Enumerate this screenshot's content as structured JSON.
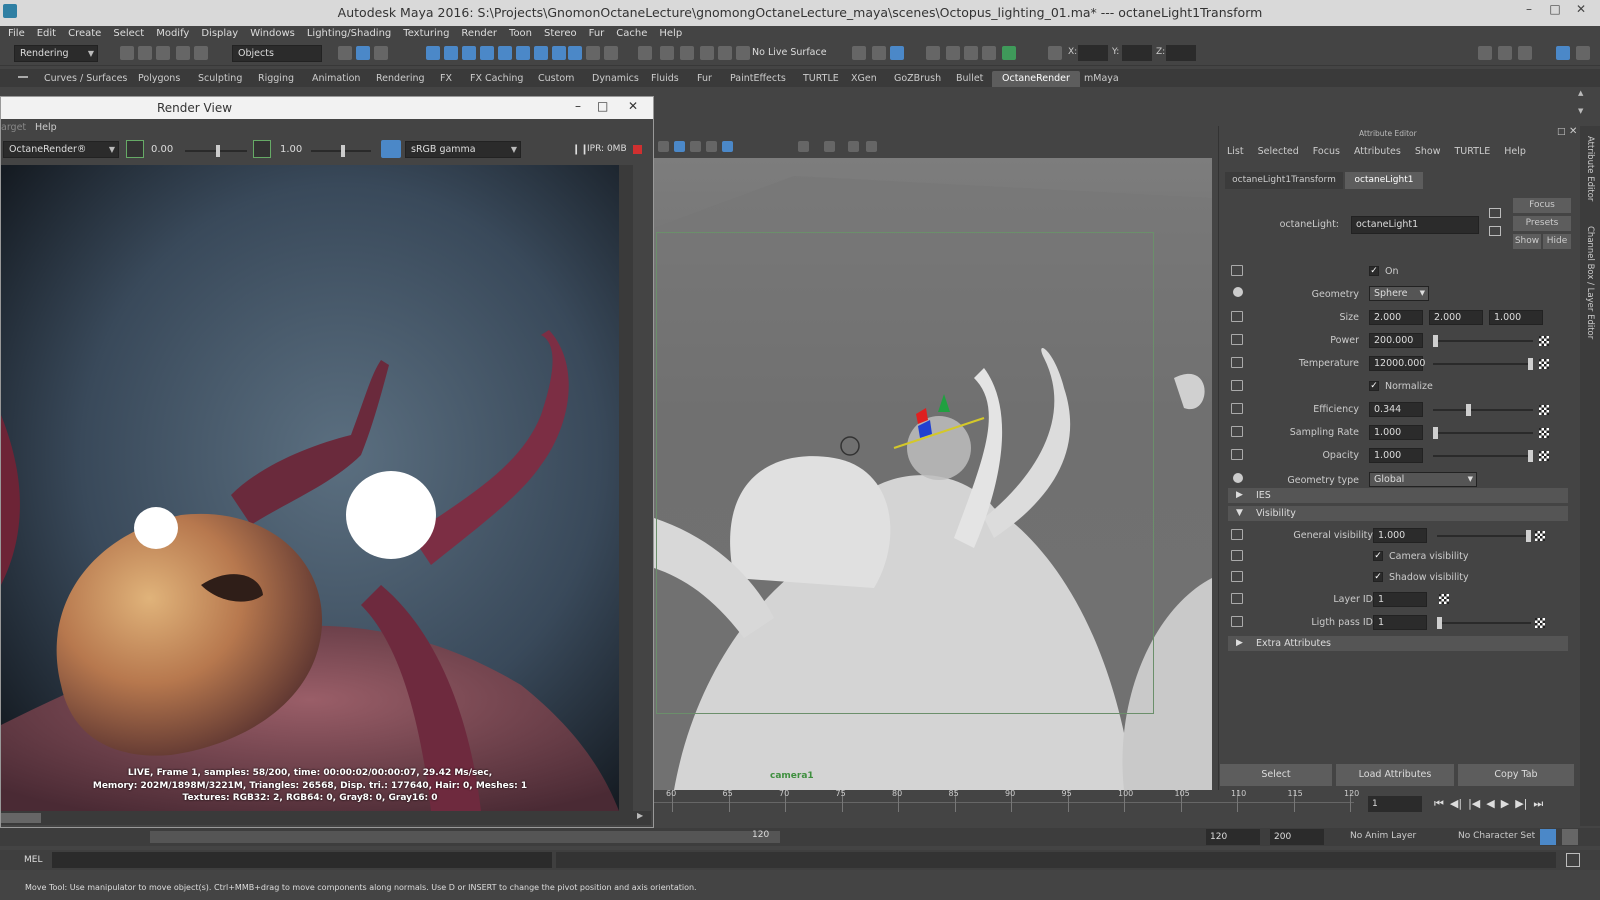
{
  "window": {
    "title": "Autodesk Maya 2016: S:\\Projects\\GnomonOctaneLecture\\gnomongOctaneLecture_maya\\scenes\\Octopus_lighting_01.ma*  ---  octaneLight1Transform"
  },
  "menu": [
    "File",
    "Edit",
    "Create",
    "Select",
    "Modify",
    "Display",
    "Windows",
    "Lighting/Shading",
    "Texturing",
    "Render",
    "Toon",
    "Stereo",
    "Fur",
    "Cache",
    "Help"
  ],
  "toolbar": {
    "mode": "Rendering",
    "selection_mode": "Objects",
    "live_surface": "No Live Surface",
    "x_label": "X:",
    "y_label": "Y:",
    "z_label": "Z:"
  },
  "shelf_tabs": [
    "Curves / Surfaces",
    "Polygons",
    "Sculpting",
    "Rigging",
    "Animation",
    "Rendering",
    "FX",
    "FX Caching",
    "Custom",
    "Dynamics",
    "Fluids",
    "Fur",
    "PaintEffects",
    "TURTLE",
    "XGen",
    "GoZBrush",
    "Bullet",
    "OctaneRender",
    "mMaya"
  ],
  "shelf_active": "OctaneRender",
  "render_view": {
    "title": "Render View",
    "menu": [
      "arget",
      "Help"
    ],
    "renderer": "OctaneRender®",
    "exposure": "0.00",
    "gamma": "1.00",
    "color_space": "sRGB gamma",
    "ipr": "IPR: 0MB",
    "stats": [
      "LIVE, Frame 1, samples: 58/200, time: 00:00:02/00:00:07, 29.42 Ms/sec,",
      "Memory: 202M/1898M/3221M, Triangles: 26568, Disp. tri.: 177640, Hair: 0, Meshes: 1",
      "Textures: RGB32: 2, RGB64: 0, Gray8: 0, Gray16: 0"
    ]
  },
  "viewport": {
    "camera_label": "camera1"
  },
  "attribute_editor": {
    "title": "Attribute Editor",
    "menu": [
      "List",
      "Selected",
      "Focus",
      "Attributes",
      "Show",
      "TURTLE",
      "Help"
    ],
    "tabs": [
      "octaneLight1Transform",
      "octaneLight1"
    ],
    "active_tab": "octaneLight1",
    "node_label": "octaneLight:",
    "node_name": "octaneLight1",
    "side_buttons": {
      "focus": "Focus",
      "presets": "Presets",
      "show": "Show",
      "hide": "Hide"
    },
    "on_label": "On",
    "geometry_label": "Geometry",
    "geometry": "Sphere",
    "size_label": "Size",
    "size": [
      "2.000",
      "2.000",
      "1.000"
    ],
    "power_label": "Power",
    "power": "200.000",
    "power_level": 0.0,
    "temperature_label": "Temperature",
    "temperature": "12000.000",
    "temperature_level": 1.0,
    "normalize_label": "Normalize",
    "efficiency_label": "Efficiency",
    "efficiency": "0.344",
    "efficiency_level": 0.344,
    "sampling_label": "Sampling Rate",
    "sampling": "1.000",
    "sampling_level": 0.0,
    "opacity_label": "Opacity",
    "opacity": "1.000",
    "opacity_level": 1.0,
    "geometry_type_label": "Geometry type",
    "geometry_type": "Global",
    "section_ies": "IES",
    "section_visibility": "Visibility",
    "general_visibility_label": "General visibility",
    "general_visibility": "1.000",
    "camera_visibility_label": "Camera visibility",
    "shadow_visibility_label": "Shadow visibility",
    "layer_id_label": "Layer ID",
    "layer_id": "1",
    "light_pass_label": "Ligth pass ID",
    "light_pass": "1",
    "section_extra": "Extra Attributes",
    "buttons": {
      "select": "Select",
      "load": "Load Attributes",
      "copy": "Copy Tab"
    }
  },
  "timeline": {
    "ticks": [
      "60",
      "65",
      "70",
      "75",
      "80",
      "85",
      "90",
      "95",
      "100",
      "105",
      "110",
      "115",
      "120"
    ],
    "current_frame": "1"
  },
  "range": {
    "end_a": "120",
    "start_b": "120",
    "end_b": "200",
    "anim_layer": "No Anim Layer",
    "char_set": "No Character Set"
  },
  "command": {
    "lang": "MEL"
  },
  "help_line": "Move Tool: Use manipulator to move object(s). Ctrl+MMB+drag to move components along normals. Use D or INSERT to change the pivot position and axis orientation.",
  "right_strip": [
    "Attribute Editor",
    "Channel Box / Layer Editor"
  ]
}
